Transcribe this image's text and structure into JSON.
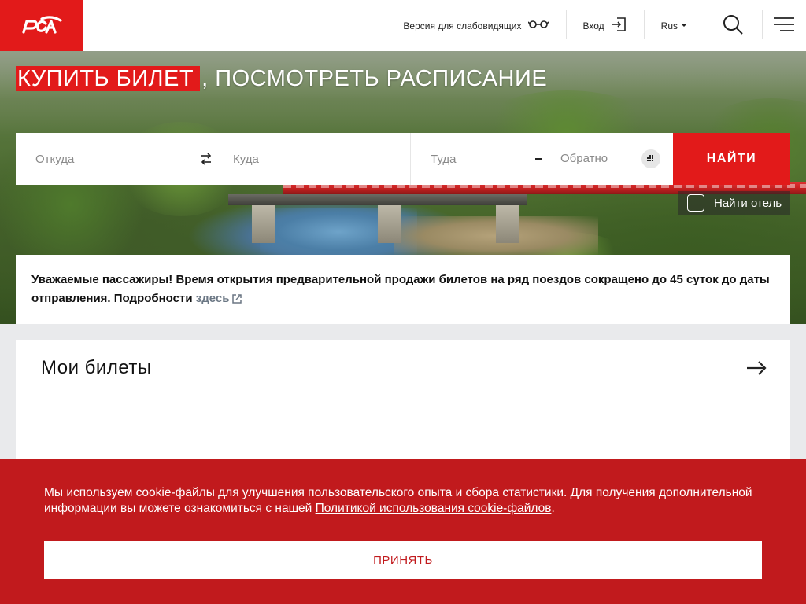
{
  "header": {
    "low_vision": "Версия для слабовидящих",
    "login": "Вход",
    "lang": "Rus",
    "icons": [
      "rzd-logo",
      "glasses-icon",
      "login-icon",
      "search-icon",
      "menu-icon"
    ]
  },
  "hero": {
    "title_highlight": "КУПИТЬ БИЛЕТ",
    "title_rest": ", ПОСМОТРЕТЬ РАСПИСАНИЕ"
  },
  "search": {
    "from_placeholder": "Откуда",
    "to_placeholder": "Куда",
    "depart_placeholder": "Туда",
    "return_placeholder": "Обратно",
    "find_label": "НАЙТИ",
    "hotel_label": "Найти отель"
  },
  "notice": {
    "text": "Уважаемые пассажиры! Время открытия предварительной продажи билетов на ряд поездов сокращено до 45 суток до даты отправления. Подробности ",
    "link": "здесь"
  },
  "tickets": {
    "title": "Мои билеты"
  },
  "cookie": {
    "text": "Мы используем cookie-файлы для улучшения пользовательского опыта и сбора статистики. Для получения дополнительной информации вы можете ознакомиться с нашей ",
    "link": "Политикой использования cookie-файлов",
    "tail": ".",
    "accept": "ПРИНЯТЬ"
  },
  "colors": {
    "brand_red": "#e21a1a",
    "cookie_red": "#c11a1d"
  }
}
